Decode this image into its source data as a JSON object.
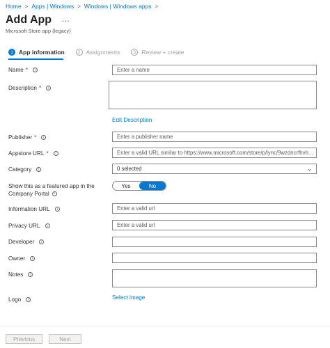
{
  "breadcrumb": {
    "items": [
      "Home",
      "Apps | Windows",
      "Windows | Windows apps"
    ]
  },
  "header": {
    "title": "Add App",
    "more_icon": "…",
    "subtitle": "Microsoft Store app (legacy)"
  },
  "wizard": {
    "steps": [
      {
        "num": "1",
        "label": "App information"
      },
      {
        "num": "2",
        "label": "Assignments"
      },
      {
        "num": "3",
        "label": "Review + create"
      }
    ]
  },
  "form": {
    "name": {
      "label": "Name",
      "required": "*",
      "placeholder": "Enter a name"
    },
    "description": {
      "label": "Description",
      "required": "*",
      "edit_link": "Edit Description"
    },
    "publisher": {
      "label": "Publisher",
      "required": "*",
      "placeholder": "Enter a publisher name"
    },
    "appstore_url": {
      "label": "Appstore URL",
      "required": "*",
      "placeholder": "Enter a valid URL similar to https://www.microsoft.com/store/p/lync/9wzdncrfhvh..."
    },
    "category": {
      "label": "Category",
      "value": "0 selected"
    },
    "featured": {
      "label_line1": "Show this as a featured app in the",
      "label_line2": "Company Portal",
      "yes": "Yes",
      "no": "No"
    },
    "information_url": {
      "label": "Information URL",
      "placeholder": "Enter a valid url"
    },
    "privacy_url": {
      "label": "Privacy URL",
      "placeholder": "Enter a valid url"
    },
    "developer": {
      "label": "Developer"
    },
    "owner": {
      "label": "Owner"
    },
    "notes": {
      "label": "Notes"
    },
    "logo": {
      "label": "Logo",
      "select_link": "Select image"
    }
  },
  "footer": {
    "previous": "Previous",
    "next": "Next"
  },
  "icons": {
    "info": "i",
    "chevron_right": ">",
    "chevron_down": "⌄"
  }
}
